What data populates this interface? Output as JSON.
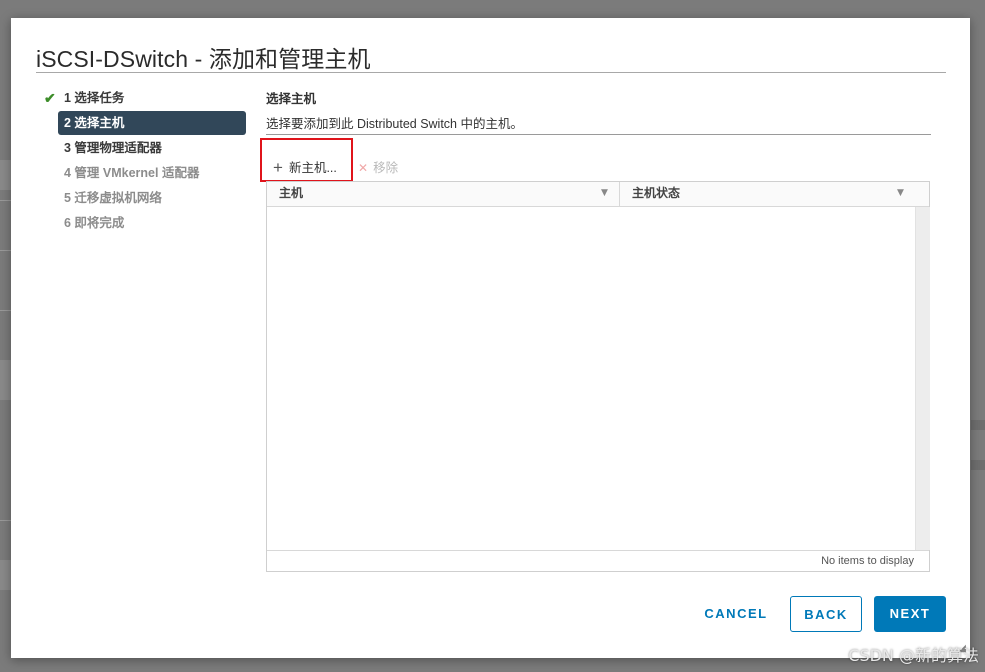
{
  "dialog": {
    "title": "iSCSI-DSwitch - 添加和管理主机"
  },
  "steps": [
    {
      "label": "1 选择任务",
      "state": "done"
    },
    {
      "label": "2 选择主机",
      "state": "active"
    },
    {
      "label": "3 管理物理适配器",
      "state": "pending"
    },
    {
      "label": "4 管理 VMkernel 适配器",
      "state": "disabled"
    },
    {
      "label": "5 迁移虚拟机网络",
      "state": "disabled"
    },
    {
      "label": "6 即将完成",
      "state": "disabled"
    }
  ],
  "section": {
    "title": "选择主机",
    "description": "选择要添加到此 Distributed Switch 中的主机。"
  },
  "toolbar": {
    "add_label": "新主机...",
    "remove_label": "移除"
  },
  "grid": {
    "columns": [
      "主机",
      "主机状态"
    ],
    "empty_text": "No items to display"
  },
  "footer": {
    "cancel_label": "CANCEL",
    "back_label": "BACK",
    "next_label": "NEXT"
  },
  "watermark": "CSDN @新的算法",
  "colors": {
    "accent": "#0079b8",
    "active_step": "#314759",
    "highlight_box": "#e0141b",
    "check": "#3d8d2a"
  },
  "icons": {
    "done_step": "check-icon",
    "add": "plus-icon",
    "remove": "remove-icon",
    "filter": "filter-icon",
    "resize": "resize-handle-icon"
  }
}
